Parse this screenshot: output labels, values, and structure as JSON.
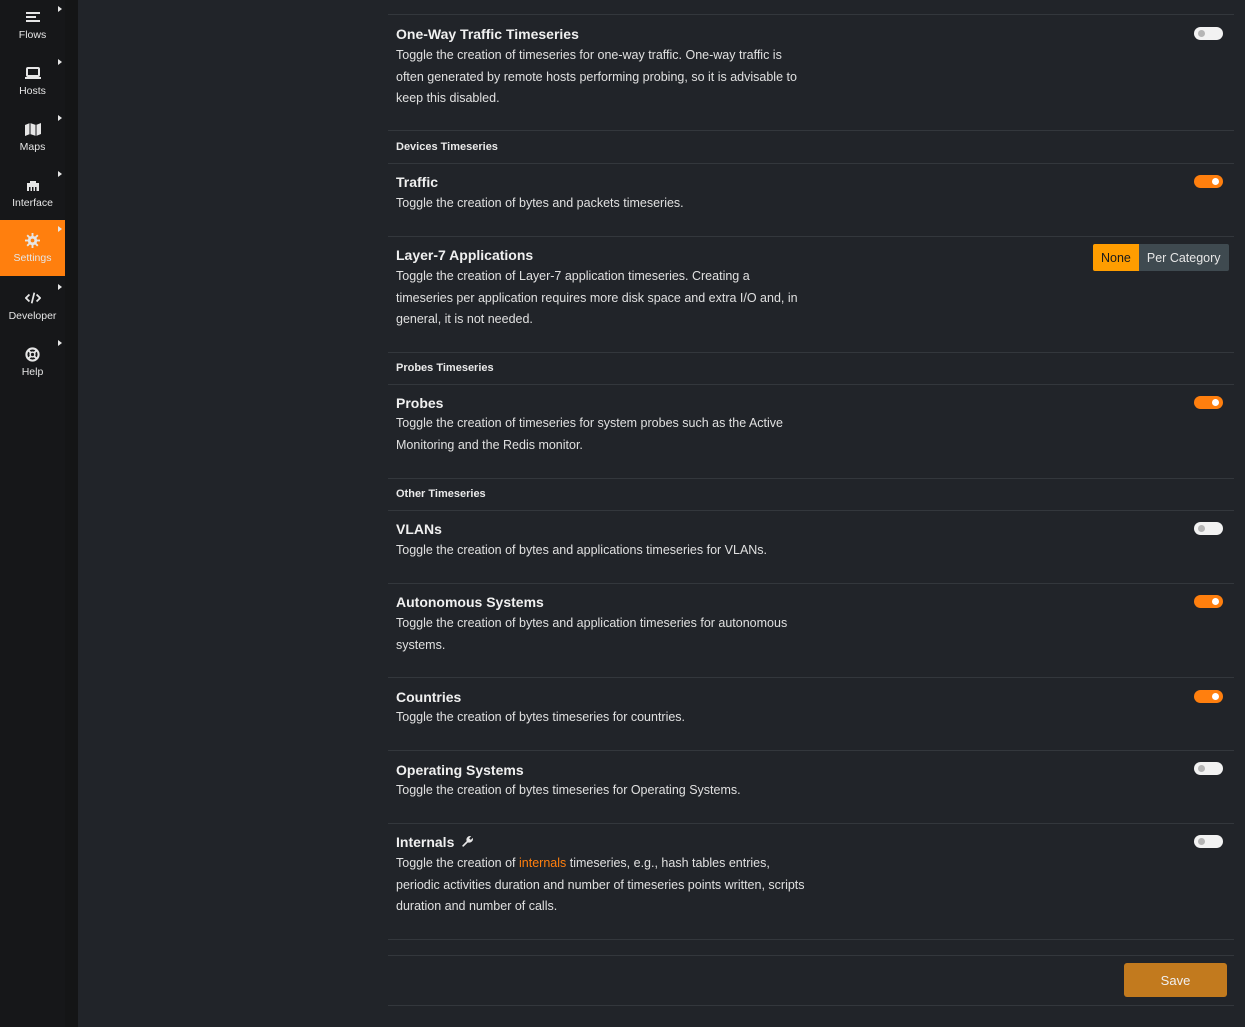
{
  "sidebar": {
    "items": [
      {
        "label": "Flows",
        "icon": "list-icon"
      },
      {
        "label": "Hosts",
        "icon": "laptop-icon"
      },
      {
        "label": "Maps",
        "icon": "map-icon"
      },
      {
        "label": "Interface",
        "icon": "ethernet-icon"
      },
      {
        "label": "Settings",
        "icon": "gear-icon",
        "active": true
      },
      {
        "label": "Developer",
        "icon": "code-icon"
      },
      {
        "label": "Help",
        "icon": "lifebuoy-icon"
      }
    ]
  },
  "rows": {
    "one_way": {
      "title": "One-Way Traffic Timeseries",
      "desc": "Toggle the creation of timeseries for one-way traffic. One-way traffic is often generated by remote hosts performing probing, so it is advisable to keep this disabled.",
      "enabled": false
    },
    "traffic": {
      "title": "Traffic",
      "desc": "Toggle the creation of bytes and packets timeseries.",
      "enabled": true
    },
    "l7": {
      "title": "Layer-7 Applications",
      "desc": "Toggle the creation of Layer-7 application timeseries. Creating a timeseries per application requires more disk space and extra I/O and, in general, it is not needed.",
      "options": [
        "None",
        "Per Category"
      ],
      "selected": "None"
    },
    "probes": {
      "title": "Probes",
      "desc": "Toggle the creation of timeseries for system probes such as the Active Monitoring and the Redis monitor.",
      "enabled": true
    },
    "vlans": {
      "title": "VLANs",
      "desc": "Toggle the creation of bytes and applications timeseries for VLANs.",
      "enabled": false
    },
    "as": {
      "title": "Autonomous Systems",
      "desc": "Toggle the creation of bytes and application timeseries for autonomous systems.",
      "enabled": true
    },
    "countries": {
      "title": "Countries",
      "desc": "Toggle the creation of bytes timeseries for countries.",
      "enabled": true
    },
    "os": {
      "title": "Operating Systems",
      "desc": "Toggle the creation of bytes timeseries for Operating Systems.",
      "enabled": false
    },
    "internals": {
      "title": "Internals",
      "desc_before": "Toggle the creation of ",
      "desc_link": "internals",
      "desc_after": " timeseries, e.g., hash tables entries, periodic activities duration and number of timeseries points written, scripts duration and number of calls.",
      "enabled": false
    }
  },
  "sections": {
    "devices": "Devices Timeseries",
    "probes": "Probes Timeseries",
    "other": "Other Timeseries"
  },
  "save_label": "Save",
  "colors": {
    "accent": "#ff7f0e",
    "background": "#212429",
    "sidebar": "#161719"
  }
}
